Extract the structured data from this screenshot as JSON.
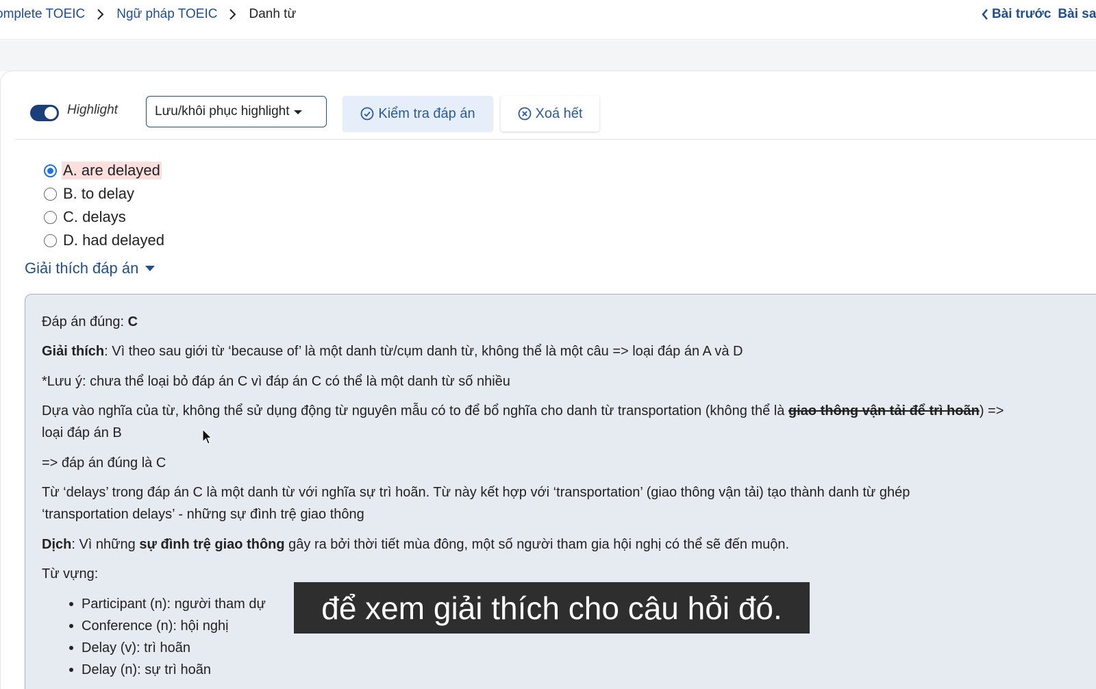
{
  "breadcrumb": {
    "items": [
      "omplete TOEIC",
      "Ngữ pháp TOEIC"
    ],
    "current": "Danh từ"
  },
  "lesson_nav": {
    "prev_label": "Bài trước",
    "next_label": "Bài sau"
  },
  "toolbar": {
    "highlight_label": "Highlight",
    "highlight_on": true,
    "save_restore_label": "Lưu/khôi phục highlight",
    "check_label": "Kiểm tra đáp án",
    "clear_label": "Xoá hết"
  },
  "question": {
    "options": [
      {
        "label": "A. are delayed",
        "checked": true
      },
      {
        "label": "B. to delay",
        "checked": false
      },
      {
        "label": "C. delays",
        "checked": false
      },
      {
        "label": "D. had delayed",
        "checked": false
      }
    ]
  },
  "explanation": {
    "toggle_label": "Giải thích đáp án",
    "answer_prefix": "Đáp án đúng: ",
    "answer": "C",
    "giai_thich_label": "Giải thích",
    "giai_thich_text": ": Vì theo sau giới từ ‘because of’ là một danh từ/cụm danh từ, không thể là một câu => loại đáp án A và D",
    "luu_y": "*Lưu ý: chưa thể loại bỏ đáp án C vì đáp án C có thể là một danh từ số nhiều",
    "dua_vao_text": "Dựa vào nghĩa của từ, không thể sử dụng động từ nguyên mẫu có to để bổ nghĩa cho danh từ transportation (không thể là ",
    "dua_vao_strike": "giao thông vận tải để trì hoãn",
    "dua_vao_end": ") =>",
    "loai_b": "loại đáp án B",
    "dap_an_dung": "=> đáp án đúng là C",
    "tu_delays_1": "Từ ‘delays’ trong đáp án C là một danh từ với nghĩa sự trì hoãn. Từ này kết hợp với ‘transportation’ (giao thông vận tải) tạo thành danh từ ghép",
    "tu_delays_2": "‘transportation delays’ - những sự đình trệ giao thông",
    "dich_label": "Dịch",
    "dich_pre": ": Vì những ",
    "dich_bold": "sự đình trệ giao thông",
    "dich_post": " gây ra bởi thời tiết mùa đông, một số người tham gia hội nghị có thể sẽ đến muộn.",
    "tu_vung_label": "Từ vựng:",
    "vocab": [
      "Participant (n): người tham dự",
      "Conference (n): hội nghị",
      "Delay (v): trì hoãn",
      "Delay (n): sự trì hoãn"
    ]
  },
  "subtitle": "để xem giải thích cho câu hỏi đó.",
  "colors": {
    "link": "#1f4f8c",
    "selected_highlight": "#fbdede",
    "explain_bg": "#e6eaf1",
    "check_btn_bg": "#e6eef9"
  }
}
